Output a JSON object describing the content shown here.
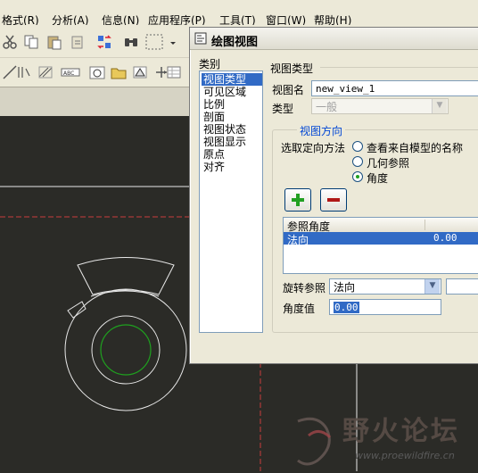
{
  "menubar": {
    "items": [
      "格式(R)",
      "分析(A)",
      "信息(N)",
      "应用程序(P)",
      "工具(T)",
      "窗口(W)",
      "帮助(H)"
    ]
  },
  "dialog": {
    "title": "绘图视图",
    "category_label": "类别",
    "categories": [
      "视图类型",
      "可见区域",
      "比例",
      "剖面",
      "视图状态",
      "视图显示",
      "原点",
      "对齐"
    ],
    "selected_category": "视图类型",
    "section_title": "视图类型",
    "view_name_label": "视图名",
    "view_name_value": "new_view_1",
    "type_label": "类型",
    "type_value": "一般",
    "orientation_group": "视图方向",
    "orientation_method_label": "选取定向方法",
    "orientation_options": [
      "查看来自模型的名称",
      "几何参照",
      "角度"
    ],
    "orientation_selected": "角度",
    "add_button_icon": "plus-icon",
    "remove_button_icon": "minus-icon",
    "ref_table": {
      "headers": [
        "参照角度",
        ""
      ],
      "rows": [
        [
          "法向",
          "0.00"
        ]
      ]
    },
    "rotation_ref_label": "旋转参照",
    "rotation_ref_value": "法向",
    "angle_value_label": "角度值",
    "angle_value": "0.00"
  },
  "watermark": {
    "brand": "野火论坛",
    "url": "www.proewildfire.cn"
  },
  "colors": {
    "canvas": "#2b2b27",
    "selection": "#316ac5",
    "dialog_bg": "#ece9d8",
    "datum_line": "#c83c3c",
    "inner_circle": "#1fa01f",
    "plus": "#22a022",
    "minus": "#b01818"
  }
}
